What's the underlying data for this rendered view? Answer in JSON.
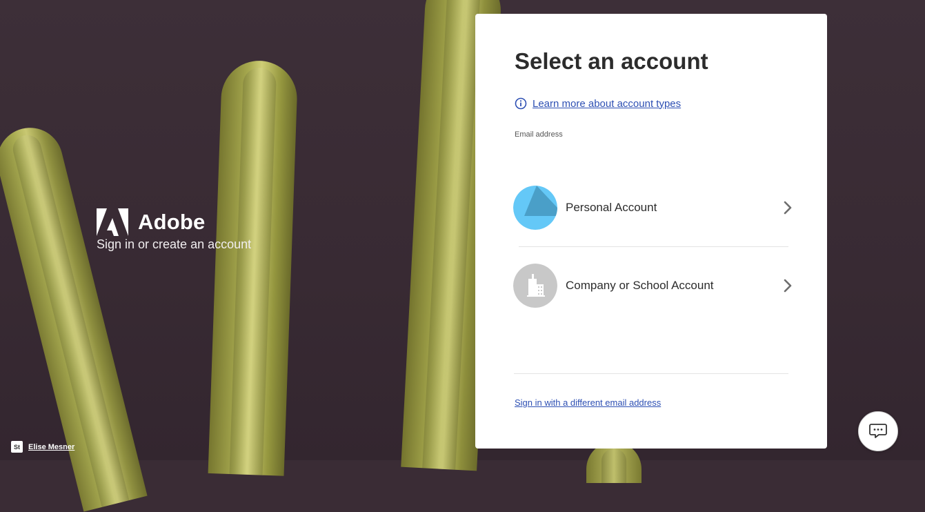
{
  "brand": {
    "name": "Adobe",
    "subtitle": "Sign in or create an account"
  },
  "card": {
    "title": "Select an account",
    "learn_more_link": "Learn more about account types",
    "email_label": "Email address",
    "accounts": [
      {
        "label": "Personal Account",
        "icon": "personal-account-icon"
      },
      {
        "label": "Company or School Account",
        "icon": "building-icon"
      }
    ],
    "different_email_link": "Sign in with a different email address"
  },
  "credit": {
    "badge": "St",
    "photographer": "Elise Mesner"
  },
  "chat": {
    "icon": "chat-icon"
  },
  "colors": {
    "link": "#2d4fb3",
    "personal_light": "#64c8f7",
    "personal_dark": "#4a9fc8",
    "company_gray": "#c8c8c8",
    "background": "#3a2c35"
  }
}
